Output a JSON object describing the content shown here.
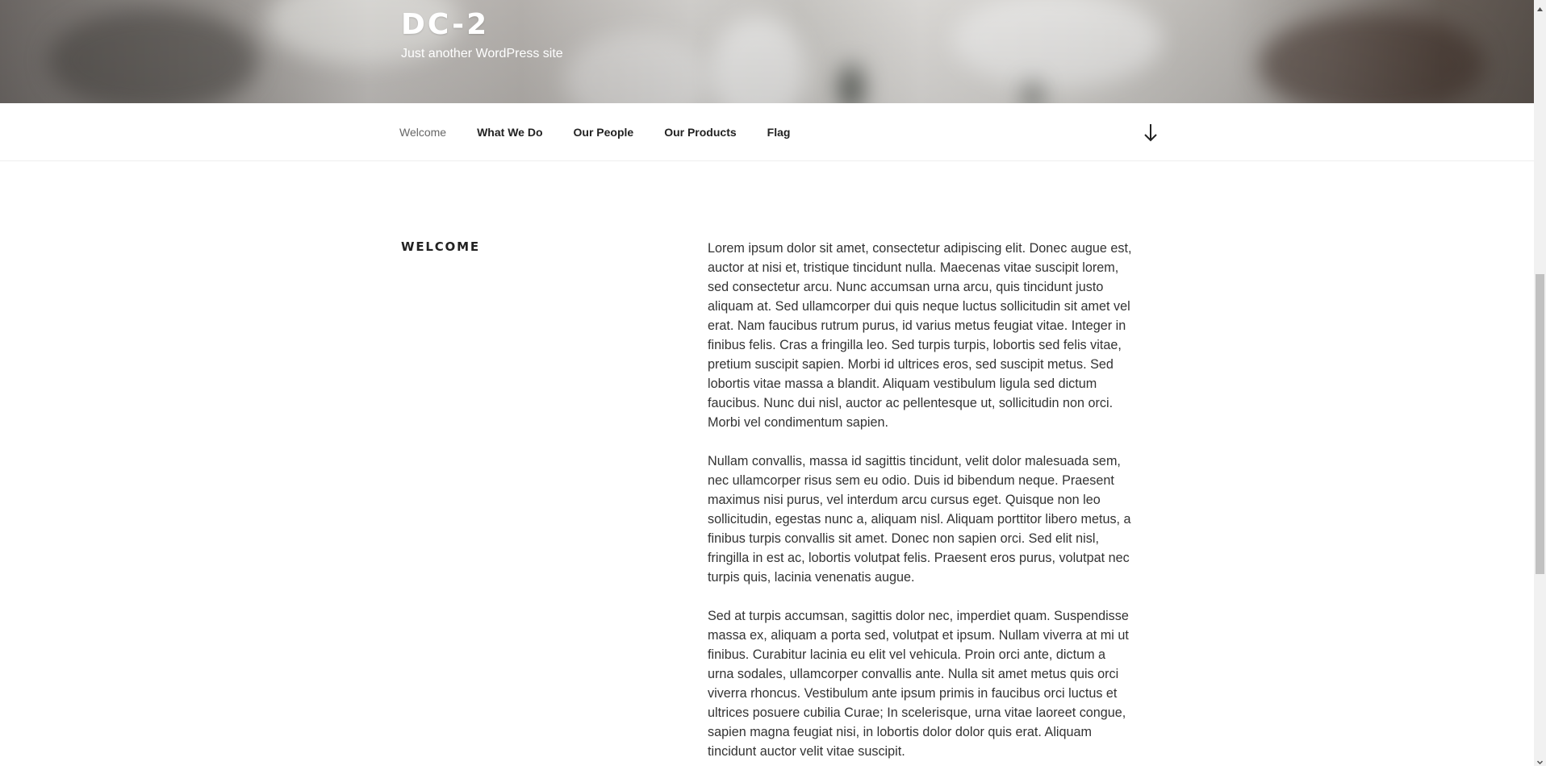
{
  "site": {
    "title": "DC-2",
    "tagline": "Just another WordPress site"
  },
  "nav": {
    "items": [
      {
        "label": "Welcome",
        "current": true
      },
      {
        "label": "What We Do"
      },
      {
        "label": "Our People"
      },
      {
        "label": "Our Products"
      },
      {
        "label": "Flag"
      }
    ],
    "scroll_icon": "arrow-down-icon"
  },
  "page": {
    "title": "WELCOME",
    "paragraphs": [
      "Lorem ipsum dolor sit amet, consectetur adipiscing elit. Donec augue est, auctor at nisi et, tristique tincidunt nulla. Maecenas vitae suscipit lorem, sed consectetur arcu. Nunc accumsan urna arcu, quis tincidunt justo aliquam at. Sed ullamcorper dui quis neque luctus sollicitudin sit amet vel erat. Nam faucibus rutrum purus, id varius metus feugiat vitae. Integer in finibus felis. Cras a fringilla leo. Sed turpis turpis, lobortis sed felis vitae, pretium suscipit sapien. Morbi id ultrices eros, sed suscipit metus. Sed lobortis vitae massa a blandit. Aliquam vestibulum ligula sed dictum faucibus. Nunc dui nisl, auctor ac pellentesque ut, sollicitudin non orci. Morbi vel condimentum sapien.",
      "Nullam convallis, massa id sagittis tincidunt, velit dolor malesuada sem, nec ullamcorper risus sem eu odio. Duis id bibendum neque. Praesent maximus nisi purus, vel interdum arcu cursus eget. Quisque non leo sollicitudin, egestas nunc a, aliquam nisl. Aliquam porttitor libero metus, a finibus turpis convallis sit amet. Donec non sapien orci. Sed elit nisl, fringilla in est ac, lobortis volutpat felis. Praesent eros purus, volutpat nec turpis quis, lacinia venenatis augue.",
      "Sed at turpis accumsan, sagittis dolor nec, imperdiet quam. Suspendisse massa ex, aliquam a porta sed, volutpat et ipsum. Nullam viverra at mi ut finibus. Curabitur lacinia eu elit vel vehicula. Proin orci ante, dictum a urna sodales, ullamcorper convallis ante. Nulla sit amet metus quis orci viverra rhoncus. Vestibulum ante ipsum primis in faucibus orci luctus et ultrices posuere cubilia Curae; In scelerisque, urna vitae laoreet congue, sapien magna feugiat nisi, in lobortis dolor dolor quis erat. Aliquam tincidunt auctor velit vitae suscipit."
    ]
  },
  "colors": {
    "text": "#222222",
    "body_text": "#333333",
    "nav_current": "#666666",
    "header_text": "#ffffff"
  }
}
